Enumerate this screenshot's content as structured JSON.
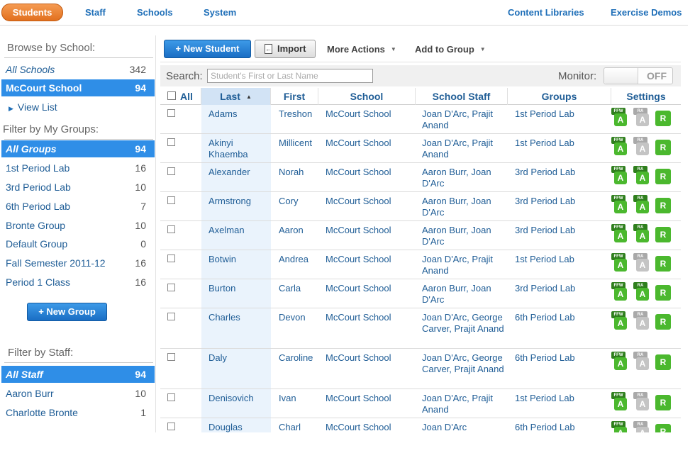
{
  "nav": {
    "active": "Students",
    "items": [
      "Staff",
      "Schools",
      "System"
    ],
    "right_items": [
      "Content Libraries",
      "Exercise Demos"
    ]
  },
  "sidebar": {
    "browse_heading": "Browse by School:",
    "schools": [
      {
        "label": "All Schools",
        "count": "342"
      },
      {
        "label": "McCourt School",
        "count": "94"
      }
    ],
    "view_list": "View List",
    "groups_heading": "Filter by My Groups:",
    "groups": [
      {
        "label": "All Groups",
        "count": "94"
      },
      {
        "label": "1st Period Lab",
        "count": "16"
      },
      {
        "label": "3rd Period Lab",
        "count": "10"
      },
      {
        "label": "6th Period Lab",
        "count": "7"
      },
      {
        "label": "Bronte Group",
        "count": "10"
      },
      {
        "label": "Default Group",
        "count": "0"
      },
      {
        "label": "Fall Semester 2011-12",
        "count": "16"
      },
      {
        "label": "Period 1 Class",
        "count": "16"
      }
    ],
    "new_group_label": "+ New Group",
    "staff_heading": "Filter by Staff:",
    "staff": [
      {
        "label": "All Staff",
        "count": "94"
      },
      {
        "label": "Aaron Burr",
        "count": "10"
      },
      {
        "label": "Charlotte Bronte",
        "count": "1"
      }
    ]
  },
  "toolbar": {
    "new_student": "+ New Student",
    "import": "Import",
    "more_actions": "More Actions",
    "add_to_group": "Add to Group"
  },
  "search": {
    "label": "Search:",
    "placeholder": "Student's First or Last Name",
    "monitor_label": "Monitor:",
    "monitor_state": "OFF"
  },
  "table": {
    "headers": {
      "all": "All",
      "last": "Last",
      "first": "First",
      "school": "School",
      "staff": "School Staff",
      "groups": "Groups",
      "settings": "Settings"
    },
    "badge_labels": {
      "ffw": "FFW",
      "ra": "RA",
      "a": "A",
      "r": "R"
    },
    "rows": [
      {
        "last": "Adams",
        "first": "Treshon",
        "school": "McCourt School",
        "staff": "Joan D'Arc, Prajit Anand",
        "group": "1st Period Lab",
        "ffw": true,
        "ra": false
      },
      {
        "last": "Akinyi Khaemba",
        "first": "Millicent",
        "school": "McCourt School",
        "staff": "Joan D'Arc, Prajit Anand",
        "group": "1st Period Lab",
        "ffw": true,
        "ra": false
      },
      {
        "last": "Alexander",
        "first": "Norah",
        "school": "McCourt School",
        "staff": "Aaron Burr, Joan D'Arc",
        "group": "3rd Period Lab",
        "ffw": true,
        "ra": true
      },
      {
        "last": "Armstrong",
        "first": "Cory",
        "school": "McCourt School",
        "staff": "Aaron Burr, Joan D'Arc",
        "group": "3rd Period Lab",
        "ffw": true,
        "ra": true
      },
      {
        "last": "Axelman",
        "first": "Aaron",
        "school": "McCourt School",
        "staff": "Aaron Burr, Joan D'Arc",
        "group": "3rd Period Lab",
        "ffw": true,
        "ra": true
      },
      {
        "last": "Botwin",
        "first": "Andrea",
        "school": "McCourt School",
        "staff": "Joan D'Arc, Prajit Anand",
        "group": "1st Period Lab",
        "ffw": true,
        "ra": false
      },
      {
        "last": "Burton",
        "first": "Carla",
        "school": "McCourt School",
        "staff": "Aaron Burr, Joan D'Arc",
        "group": "3rd Period Lab",
        "ffw": true,
        "ra": true
      },
      {
        "last": "Charles",
        "first": "Devon",
        "school": "McCourt School",
        "staff": "Joan D'Arc, George Carver, Prajit Anand",
        "group": "6th Period Lab",
        "ffw": true,
        "ra": false
      },
      {
        "last": "Daly",
        "first": "Caroline",
        "school": "McCourt School",
        "staff": "Joan D'Arc, George Carver, Prajit Anand",
        "group": "6th Period Lab",
        "ffw": true,
        "ra": false
      },
      {
        "last": "Denisovich",
        "first": "Ivan",
        "school": "McCourt School",
        "staff": "Joan D'Arc, Prajit Anand",
        "group": "1st Period Lab",
        "ffw": true,
        "ra": false
      },
      {
        "last": "Douglas",
        "first": "Charl",
        "school": "McCourt School",
        "staff": "Joan D'Arc",
        "group": "6th Period Lab",
        "ffw": true,
        "ra": false
      }
    ]
  }
}
